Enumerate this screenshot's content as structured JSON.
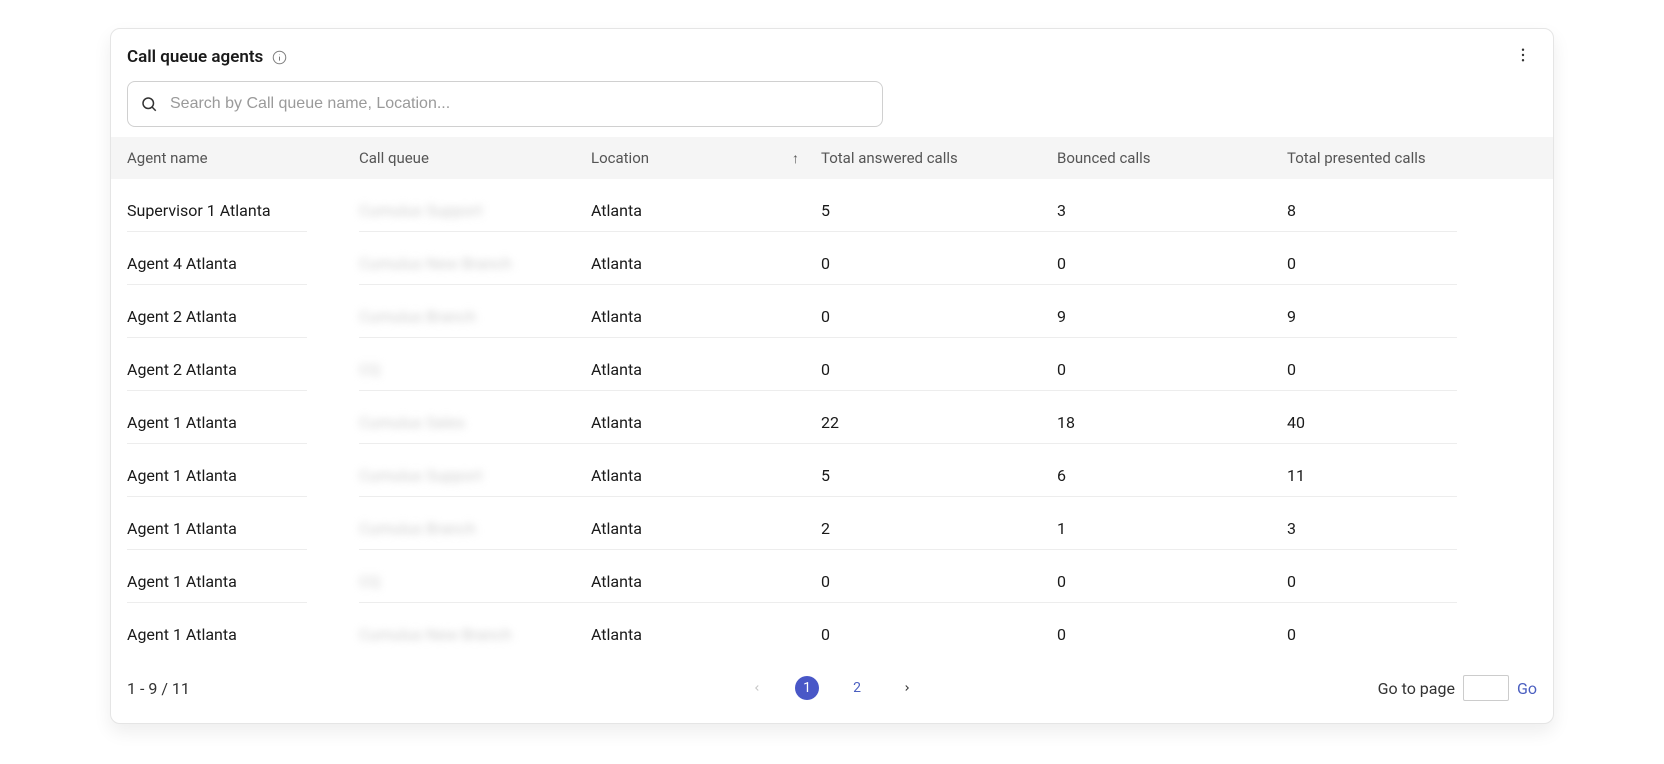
{
  "title": "Call queue agents",
  "search": {
    "placeholder": "Search by Call queue name, Location..."
  },
  "columns": {
    "agent": "Agent name",
    "queue": "Call queue",
    "location": "Location",
    "answered": "Total answered calls",
    "bounced": "Bounced calls",
    "presented": "Total presented calls"
  },
  "sort": {
    "column": "location",
    "direction": "asc"
  },
  "rows": [
    {
      "agent": "Supervisor 1 Atlanta",
      "queue": "Cumulus Support",
      "location": "Atlanta",
      "answered": "5",
      "bounced": "3",
      "presented": "8"
    },
    {
      "agent": "Agent 4 Atlanta",
      "queue": "Cumulus New Branch",
      "location": "Atlanta",
      "answered": "0",
      "bounced": "0",
      "presented": "0"
    },
    {
      "agent": "Agent 2 Atlanta",
      "queue": "Cumulus Branch",
      "location": "Atlanta",
      "answered": "0",
      "bounced": "9",
      "presented": "9"
    },
    {
      "agent": "Agent 2 Atlanta",
      "queue": "CQ",
      "location": "Atlanta",
      "answered": "0",
      "bounced": "0",
      "presented": "0"
    },
    {
      "agent": "Agent 1 Atlanta",
      "queue": "Cumulus Sales",
      "location": "Atlanta",
      "answered": "22",
      "bounced": "18",
      "presented": "40"
    },
    {
      "agent": "Agent 1 Atlanta",
      "queue": "Cumulus Support",
      "location": "Atlanta",
      "answered": "5",
      "bounced": "6",
      "presented": "11"
    },
    {
      "agent": "Agent 1 Atlanta",
      "queue": "Cumulus Branch",
      "location": "Atlanta",
      "answered": "2",
      "bounced": "1",
      "presented": "3"
    },
    {
      "agent": "Agent 1 Atlanta",
      "queue": "CQ",
      "location": "Atlanta",
      "answered": "0",
      "bounced": "0",
      "presented": "0"
    },
    {
      "agent": "Agent 1 Atlanta",
      "queue": "Cumulus New Branch",
      "location": "Atlanta",
      "answered": "0",
      "bounced": "0",
      "presented": "0"
    }
  ],
  "pagination": {
    "range_text": "1 - 9 / 11",
    "pages": [
      "1",
      "2"
    ],
    "current_page": "1",
    "goto_label": "Go to page",
    "go_label": "Go"
  }
}
